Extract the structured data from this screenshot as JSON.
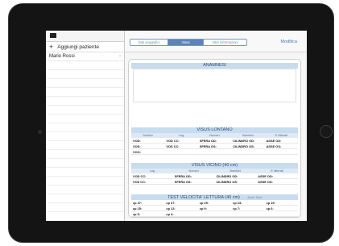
{
  "sidebar": {
    "add_label": "Aggiungi paziente",
    "patients": [
      {
        "name": "Mario Rossi"
      }
    ]
  },
  "toolbar": {
    "segments": [
      "Dati anagrafici",
      "Visus",
      "Altre informazioni"
    ],
    "active_segment": "Visus",
    "edit_label": "Modifica"
  },
  "anamnesi": {
    "title": "ANAMNESI"
  },
  "visus_lontano": {
    "title": "VISUS LONTANO",
    "columns": [
      "Snellen",
      "Log",
      "Numeri",
      "Bambini",
      "E illiterati"
    ],
    "rows": [
      [
        "VOD:",
        "VOD CC:",
        "SFERA OD:",
        "CILINDRO OD:",
        "ASSE OD:"
      ],
      [
        "VOS:",
        "VOS CC:",
        "SFERA OS:",
        "CILINDRO OS:",
        "ASSE OS:"
      ],
      [
        "VOO:",
        "",
        "",
        "",
        ""
      ]
    ]
  },
  "visus_vicino": {
    "title": "VISUS VICINO (40 cm)",
    "columns": [
      "Log",
      "Numeri",
      "Bambini",
      "E illiterati"
    ],
    "rows": [
      [
        "VOD CC:",
        "SFERA OD:",
        "CILINDRO OD:",
        "ASSE OD:"
      ],
      [
        "VOS CC:",
        "SFERA OS:",
        "CILINDRO OS:",
        "ASSE OS:"
      ]
    ]
  },
  "test_velocita": {
    "title": "TEST VELOCITA' LETTURA (40 cm)",
    "side_label": "Arvin Test",
    "rows": [
      [
        "cp 47:",
        "cp 37:",
        "cp 29:",
        "cp 23:",
        "cp 19:"
      ],
      [
        "cp 15:",
        "cp 12:",
        "cp 9:",
        "cp 7:",
        "cp 6:"
      ],
      [
        "cp 5:",
        "cp 4:",
        "",
        "",
        ""
      ]
    ]
  },
  "colors": {
    "accent": "#5d84b8",
    "header_bg": "#c7dcef",
    "subheader_bg": "#dde9f4"
  }
}
